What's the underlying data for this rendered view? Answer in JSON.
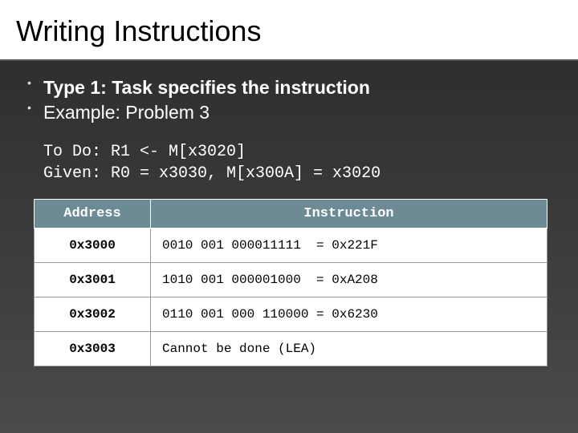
{
  "title": "Writing Instructions",
  "bullets": [
    "Type 1: Task specifies the instruction",
    "Example: Problem 3"
  ],
  "code": "To Do: R1 <- M[x3020]\nGiven: R0 = x3030, M[x300A] = x3020",
  "table": {
    "headers": [
      "Address",
      "Instruction"
    ],
    "rows": [
      {
        "addr": "0x3000",
        "instr": "0010 001 000011111  = 0x221F"
      },
      {
        "addr": "0x3001",
        "instr": "1010 001 000001000  = 0xA208"
      },
      {
        "addr": "0x3002",
        "instr": "0110 001 000 110000 = 0x6230"
      },
      {
        "addr": "0x3003",
        "instr": "Cannot be done (LEA)"
      }
    ]
  }
}
